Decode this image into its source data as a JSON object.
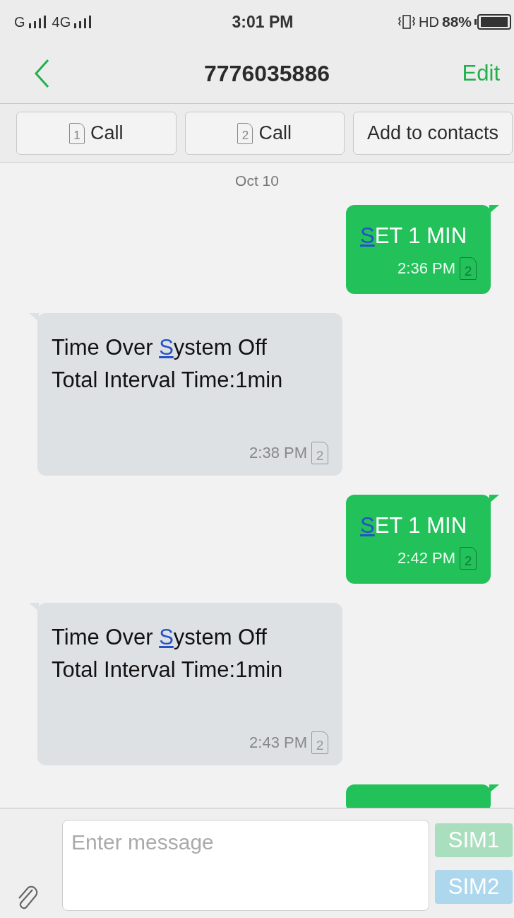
{
  "status_bar": {
    "signal_1": "G",
    "signal_2": "4G",
    "time": "3:01 PM",
    "hd": "HD",
    "battery": "88%"
  },
  "header": {
    "title": "7776035886",
    "edit": "Edit"
  },
  "actions": [
    {
      "kind": "sim-call",
      "sim": "1",
      "label": "Call"
    },
    {
      "kind": "sim-call",
      "sim": "2",
      "label": "Call"
    },
    {
      "kind": "plain",
      "label": "Add to contacts"
    }
  ],
  "date": "Oct 10",
  "messages": [
    {
      "kind": "sent",
      "lines": [
        [
          {
            "text": "S",
            "marked": true
          },
          {
            "text": "ET 1 MIN",
            "marked": false
          }
        ]
      ],
      "time": "2:36 PM",
      "sim": "2"
    },
    {
      "kind": "received",
      "lines": [
        [
          {
            "text": "Time Over ",
            "marked": false
          },
          {
            "text": "S",
            "marked": true
          },
          {
            "text": "ystem Off",
            "marked": false
          }
        ],
        [
          {
            "text": "Total Interval Time:1min",
            "marked": false
          }
        ]
      ],
      "time": "2:38 PM",
      "sim": "2"
    },
    {
      "kind": "sent",
      "lines": [
        [
          {
            "text": "S",
            "marked": true
          },
          {
            "text": "ET 1 MIN",
            "marked": false
          }
        ]
      ],
      "time": "2:42 PM",
      "sim": "2"
    },
    {
      "kind": "received",
      "lines": [
        [
          {
            "text": "Time Over ",
            "marked": false
          },
          {
            "text": "S",
            "marked": true
          },
          {
            "text": "ystem Off",
            "marked": false
          }
        ],
        [
          {
            "text": "Total Interval Time:1min",
            "marked": false
          }
        ]
      ],
      "time": "2:43 PM",
      "sim": "2"
    },
    {
      "kind": "sent"
    }
  ],
  "composer": {
    "placeholder": "Enter message",
    "send_buttons": [
      {
        "label": "SIM1",
        "color": "#a9dfbe"
      },
      {
        "label": "SIM2",
        "color": "#acd7ec"
      }
    ]
  }
}
